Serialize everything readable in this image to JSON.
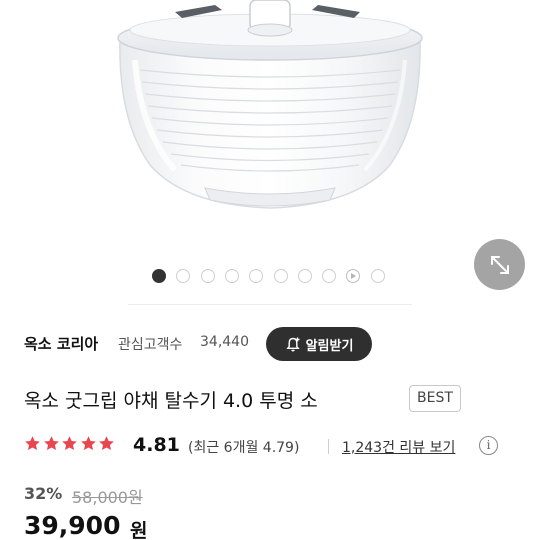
{
  "gallery": {
    "image_alt": "옥소 굿그립 야채 탈수기 4.0 투명 소",
    "dot_count": 10,
    "active_index": 0,
    "video_index": 8
  },
  "seller": {
    "name": "옥소 코리아",
    "follower_label": "관심고객수",
    "follower_count": "34,440",
    "alert_button_label": "알림받기"
  },
  "product": {
    "title": "옥소 굿그립 야채 탈수기 4.0 투명 소",
    "badge": "BEST"
  },
  "rating": {
    "stars": 5,
    "score": "4.81",
    "recent": "(최근 6개월 4.79)",
    "review_link": "1,243건 리뷰 보기",
    "info_icon": "i",
    "star_color": "#e8474f"
  },
  "price": {
    "discount_rate": "32%",
    "original_price": "58,000원",
    "sale_price": "39,900",
    "unit": "원"
  }
}
